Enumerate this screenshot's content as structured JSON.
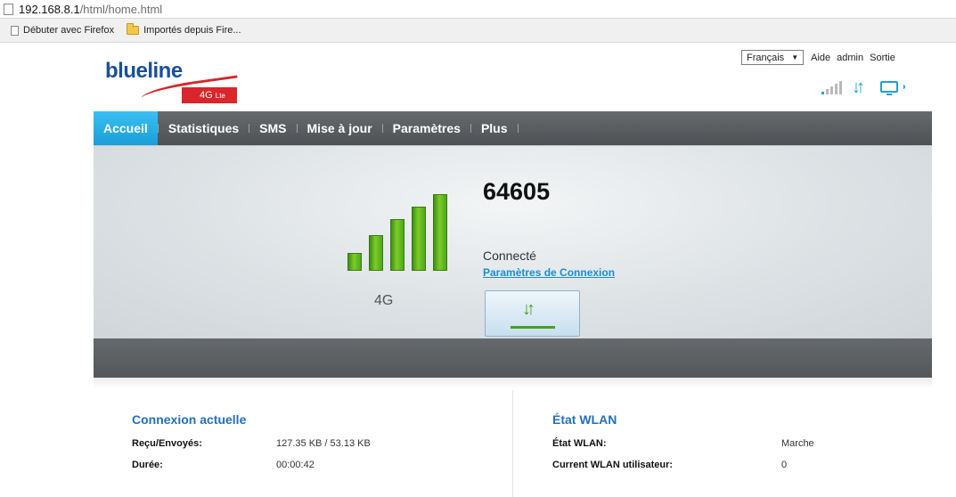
{
  "browser": {
    "url_host": "192.168.8.1",
    "url_path": "/html/home.html",
    "bookmarks": [
      {
        "label": "Débuter avec Firefox"
      },
      {
        "label": "Importés depuis Fire..."
      }
    ]
  },
  "header": {
    "logo_text": "blueline",
    "logo_badge": "4G",
    "logo_badge_suffix": "Lte",
    "language": "Français",
    "links": {
      "help": "Aide",
      "admin": "admin",
      "logout": "Sortie"
    }
  },
  "status_icons": {
    "signal_icon": "signal-strength-icon",
    "data_icon": "up-down-arrows-icon",
    "device_icon": "monitor-icon",
    "accent_color": "#1fa0d9",
    "signal_bars_lit": 1,
    "signal_bars_total": 5
  },
  "nav": {
    "items": [
      {
        "label": "Accueil",
        "active": true
      },
      {
        "label": "Statistiques"
      },
      {
        "label": "SMS"
      },
      {
        "label": "Mise à jour"
      },
      {
        "label": "Paramètres"
      },
      {
        "label": "Plus"
      }
    ],
    "active_color": "#1fa0d9"
  },
  "connection": {
    "signal_level": 5,
    "signal_max": 5,
    "network_type": "4G",
    "operator": "64605",
    "status": "Connecté",
    "settings_link": "Paramètres de Connexion",
    "button_icon": "connect-arrows-icon"
  },
  "current_connection": {
    "title": "Connexion actuelle",
    "rows": [
      {
        "label": "Reçu/Envoyés:",
        "value": "127.35 KB / 53.13 KB"
      },
      {
        "label": "Durée:",
        "value": "00:00:42"
      }
    ]
  },
  "wlan": {
    "title": "État WLAN",
    "rows": [
      {
        "label": "État WLAN:",
        "value": "Marche"
      },
      {
        "label": "Current WLAN utilisateur:",
        "value": "0"
      }
    ]
  }
}
